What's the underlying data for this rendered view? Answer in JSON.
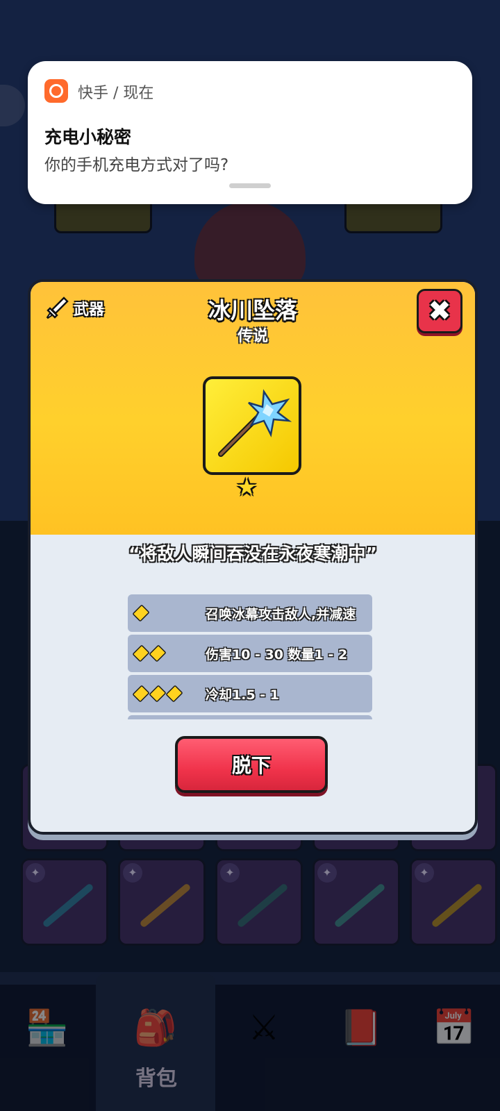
{
  "notification": {
    "app_icon": "kuaishou-app-icon",
    "source": "快手 / 现在",
    "title": "充电小秘密",
    "body": "你的手机充电方式对了吗?"
  },
  "item_dialog": {
    "category_icon": "sword-icon",
    "category_label": "武器",
    "item_name": "冰川坠落",
    "rarity": "传说",
    "star_count": 1,
    "quote": "“将敌人瞬间吞没在永夜寒潮中”",
    "attributes": [
      {
        "gems": 1,
        "text": "召唤冰幕攻击敌人,并减速"
      },
      {
        "gems": 2,
        "text": "伤害10 - 30 数量1 - 2"
      },
      {
        "gems": 3,
        "text": "冷却1.5 - 1"
      }
    ],
    "unequip_label": "脱下",
    "close_icon": "close-icon"
  },
  "bottom_nav": {
    "active_label": "背包",
    "items": [
      "shop-icon",
      "backpack-icon",
      "battle-icon",
      "codex-icon",
      "calendar-icon"
    ]
  },
  "colors": {
    "dialog_top": "#ffc23a",
    "close_button": "#e8334a",
    "unequip_button": "#f0334b",
    "notification_icon": "#ff6a2c"
  }
}
